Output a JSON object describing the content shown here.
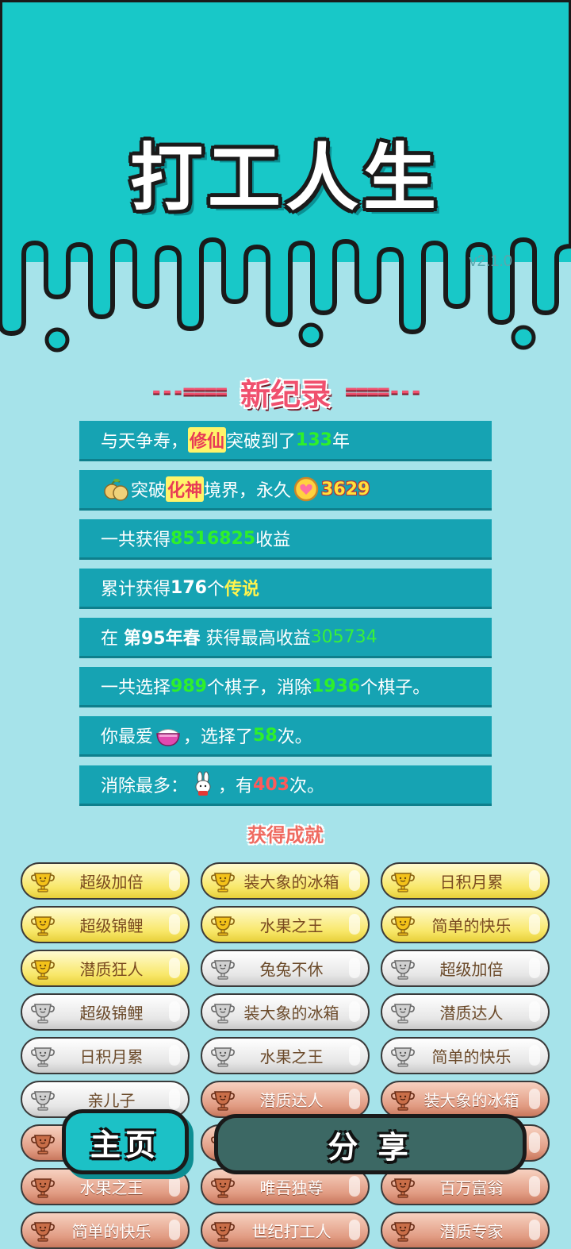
{
  "header": {
    "title": "打工人生",
    "version": "v2.1.0",
    "colors": {
      "teal": "#18c8c8",
      "bg": "#a6e3ea"
    }
  },
  "record": {
    "dashes_left": "---====",
    "title": "新纪录",
    "dashes_right": "====---"
  },
  "stats": {
    "row1": {
      "prefix": "与天争寿，",
      "highlight": "修仙",
      "middle": "突破到了",
      "value": "133",
      "suffix": "年"
    },
    "row2": {
      "icon": "fruit-icon",
      "prefix": "突破",
      "highlight": "化神",
      "middle": "境界，永久",
      "coin_icon": "heart-coin-icon",
      "value": "3629"
    },
    "row3": {
      "prefix": "一共获得",
      "value": "8516825",
      "suffix": "收益"
    },
    "row4": {
      "prefix": "累计获得",
      "value": "176",
      "middle": "个",
      "highlight": "传说"
    },
    "row5": {
      "prefix": "在 ",
      "bold": "第95年春",
      "middle": " 获得最高收益",
      "value": "305734"
    },
    "row6": {
      "prefix": "一共选择",
      "value1": "989",
      "middle": "个棋子，消除",
      "value2": "1936",
      "suffix": "个棋子。"
    },
    "row7": {
      "prefix": "你最爱",
      "icon": "rice-bowl-icon",
      "middle": "，选择了",
      "value": "58",
      "suffix": "次。"
    },
    "row8": {
      "prefix": "消除最多：",
      "icon": "rabbit-icon",
      "middle": "，有",
      "value": "403",
      "suffix": "次。"
    }
  },
  "achievements": {
    "title": "获得成就",
    "items": [
      {
        "label": "超级加倍",
        "tier": "gold"
      },
      {
        "label": "装大象的冰箱",
        "tier": "gold"
      },
      {
        "label": "日积月累",
        "tier": "gold"
      },
      {
        "label": "超级锦鲤",
        "tier": "gold"
      },
      {
        "label": "水果之王",
        "tier": "gold"
      },
      {
        "label": "简单的快乐",
        "tier": "gold"
      },
      {
        "label": "潜质狂人",
        "tier": "gold"
      },
      {
        "label": "兔兔不休",
        "tier": "silver"
      },
      {
        "label": "超级加倍",
        "tier": "silver"
      },
      {
        "label": "超级锦鲤",
        "tier": "silver"
      },
      {
        "label": "装大象的冰箱",
        "tier": "silver"
      },
      {
        "label": "潜质达人",
        "tier": "silver"
      },
      {
        "label": "日积月累",
        "tier": "silver"
      },
      {
        "label": "水果之王",
        "tier": "silver"
      },
      {
        "label": "简单的快乐",
        "tier": "silver"
      },
      {
        "label": "亲儿子",
        "tier": "silver"
      },
      {
        "label": "潜质达人",
        "tier": "bronze"
      },
      {
        "label": "装大象的冰箱",
        "tier": "bronze"
      },
      {
        "label": "",
        "tier": "bronze"
      },
      {
        "label": "",
        "tier": "bronze"
      },
      {
        "label": "",
        "tier": "bronze"
      },
      {
        "label": "水果之王",
        "tier": "bronze"
      },
      {
        "label": "唯吾独尊",
        "tier": "bronze"
      },
      {
        "label": "百万富翁",
        "tier": "bronze"
      },
      {
        "label": "简单的快乐",
        "tier": "bronze"
      },
      {
        "label": "世纪打工人",
        "tier": "bronze"
      },
      {
        "label": "潜质专家",
        "tier": "bronze"
      }
    ]
  },
  "buttons": {
    "home": "主页",
    "share": "分 享"
  }
}
